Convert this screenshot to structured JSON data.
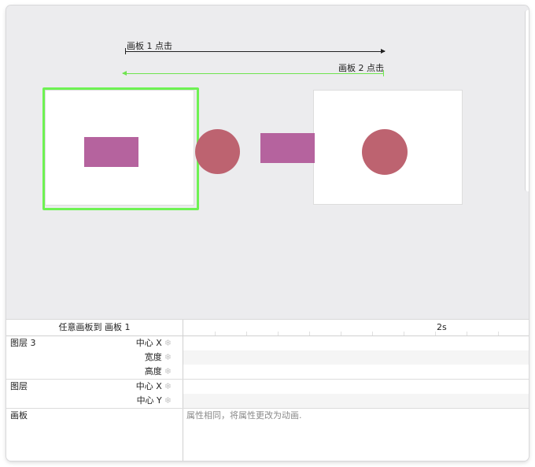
{
  "canvas": {
    "arrows": [
      {
        "label": "画板 1 点击",
        "color": "#222222",
        "direction": "right"
      },
      {
        "label": "画板 2 点击",
        "color": "#6fe44f",
        "direction": "left"
      }
    ],
    "colors": {
      "shape_rect": "#b5639e",
      "shape_circle": "#bd6370",
      "selection": "#6ef253",
      "background": "#ececee"
    }
  },
  "timeline": {
    "title": "任意画板到 画板 1",
    "time_label": "2s",
    "rows": [
      {
        "layer": "图层 3",
        "property": "中心 X",
        "icon": "snowflake-icon"
      },
      {
        "layer": "",
        "property": "宽度",
        "icon": "snowflake-icon"
      },
      {
        "layer": "",
        "property": "高度",
        "icon": "snowflake-icon"
      },
      {
        "layer": "图层",
        "property": "中心 X",
        "icon": "snowflake-icon"
      },
      {
        "layer": "",
        "property": "中心 Y",
        "icon": "snowflake-icon"
      },
      {
        "layer": "画板",
        "property": "",
        "hint": "属性相同，将属性更改为动画."
      }
    ]
  }
}
